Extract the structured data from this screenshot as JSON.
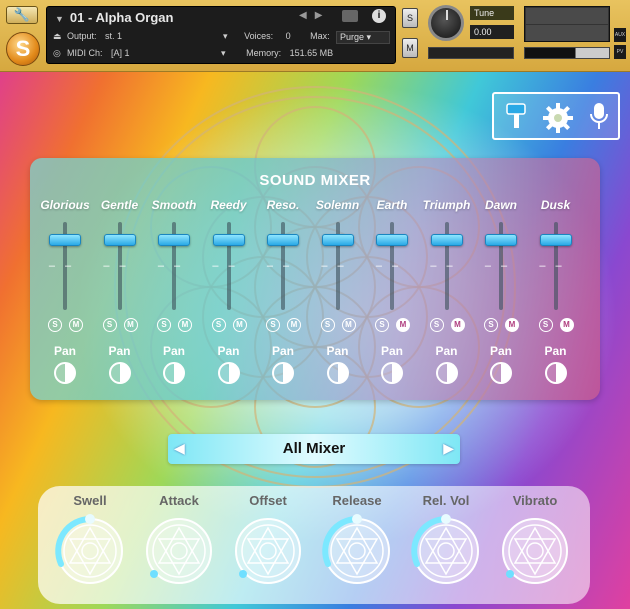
{
  "header": {
    "wrench_icon": "wrench-icon",
    "logo_letter": "S",
    "instrument": {
      "name": "01 - Alpha Organ",
      "output_label": "Output:",
      "output_value": "st. 1",
      "voices_label": "Voices:",
      "voices_value": "0",
      "max_label": "Max:",
      "max_value": "512",
      "purge_label": "Purge",
      "midi_label": "MIDI Ch:",
      "midi_value": "[A]  1",
      "memory_label": "Memory:",
      "memory_value": "151.65 MB"
    },
    "solo_label": "S",
    "mute_label": "M",
    "tune_label": "Tune",
    "tune_value": "0.00",
    "aux_label": "AUX",
    "pv_label": "PV"
  },
  "toolbar_icons": [
    "brush-icon",
    "gear-icon",
    "microphone-icon"
  ],
  "mixer": {
    "title": "SOUND MIXER",
    "channels": [
      {
        "name": "Glorious",
        "solo": "S",
        "mute": "M",
        "pan_label": "Pan",
        "mute_on": false
      },
      {
        "name": "Gentle",
        "solo": "S",
        "mute": "M",
        "pan_label": "Pan",
        "mute_on": false
      },
      {
        "name": "Smooth",
        "solo": "S",
        "mute": "M",
        "pan_label": "Pan",
        "mute_on": false
      },
      {
        "name": "Reedy",
        "solo": "S",
        "mute": "M",
        "pan_label": "Pan",
        "mute_on": false
      },
      {
        "name": "Reso.",
        "solo": "S",
        "mute": "M",
        "pan_label": "Pan",
        "mute_on": false
      },
      {
        "name": "Solemn",
        "solo": "S",
        "mute": "M",
        "pan_label": "Pan",
        "mute_on": false
      },
      {
        "name": "Earth",
        "solo": "S",
        "mute": "M",
        "pan_label": "Pan",
        "mute_on": true
      },
      {
        "name": "Triumph",
        "solo": "S",
        "mute": "M",
        "pan_label": "Pan",
        "mute_on": true
      },
      {
        "name": "Dawn",
        "solo": "S",
        "mute": "M",
        "pan_label": "Pan",
        "mute_on": true
      },
      {
        "name": "Dusk",
        "solo": "S",
        "mute": "M",
        "pan_label": "Pan",
        "mute_on": true
      }
    ]
  },
  "selector": {
    "left_arrow": "◀",
    "value": "All Mixer",
    "right_arrow": "▶"
  },
  "knobs": [
    {
      "label": "Swell",
      "active": true
    },
    {
      "label": "Attack",
      "active": false
    },
    {
      "label": "Offset",
      "active": false
    },
    {
      "label": "Release",
      "active": true
    },
    {
      "label": "Rel. Vol",
      "active": true
    },
    {
      "label": "Vibrato",
      "active": false
    }
  ],
  "colors": {
    "header": "#d6a83f",
    "fader": "#2aa9e6",
    "mixer_left": "#78d7d2",
    "mixer_right": "#c85a8c"
  }
}
